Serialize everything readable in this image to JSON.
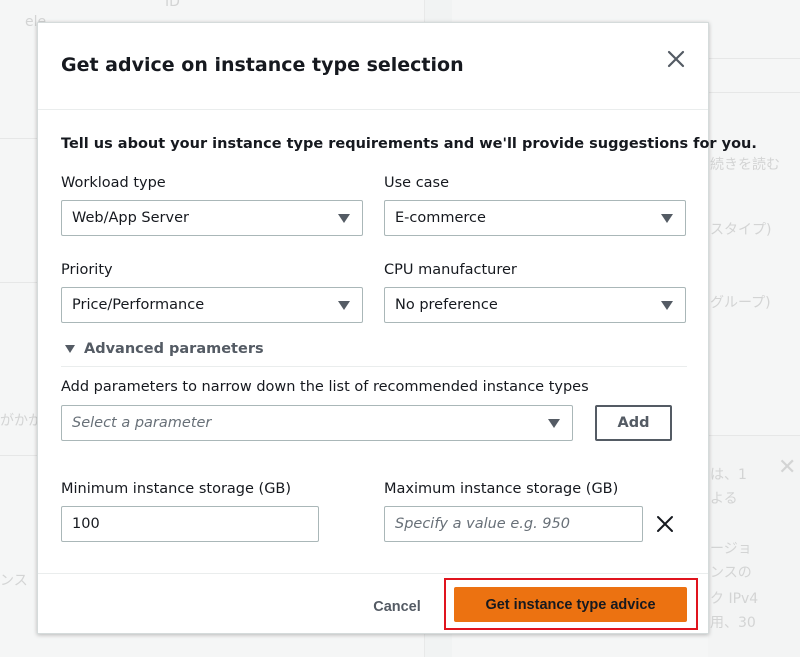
{
  "background": {
    "texts": [
      "ele",
      "ID",
      "続きを読む",
      "スタイプ)",
      "グループ)",
      "がかか",
      "は、1",
      "よる",
      "ージョ",
      "ンスの",
      "ク IPv4",
      "用、30",
      "ンス"
    ]
  },
  "modal": {
    "title": "Get advice on instance type selection",
    "intro": "Tell us about your instance type requirements and we'll provide suggestions for you.",
    "workload_type": {
      "label": "Workload type",
      "value": "Web/App Server"
    },
    "use_case": {
      "label": "Use case",
      "value": "E-commerce"
    },
    "priority": {
      "label": "Priority",
      "value": "Price/Performance"
    },
    "cpu_manufacturer": {
      "label": "CPU manufacturer",
      "value": "No preference"
    },
    "advanced": {
      "toggle_label": "Advanced parameters",
      "params_label": "Add parameters to narrow down the list of recommended instance types",
      "param_select_placeholder": "Select a parameter",
      "add_label": "Add",
      "min_storage_label": "Minimum instance storage (GB)",
      "min_storage_value": "100",
      "max_storage_label": "Maximum instance storage (GB)",
      "max_storage_placeholder": "Specify a value e.g. 950"
    },
    "footer": {
      "cancel_label": "Cancel",
      "primary_label": "Get instance type advice"
    }
  },
  "colors": {
    "primary": "#ec7211",
    "highlight": "#e0141e",
    "text": "#16191f",
    "secondary_text": "#545b64"
  }
}
